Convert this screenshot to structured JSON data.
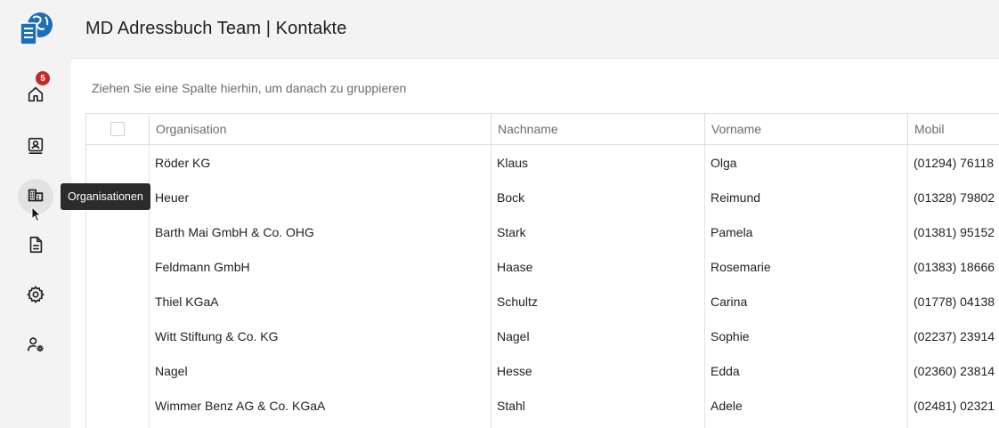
{
  "header": {
    "title": "MD Adressbuch Team | Kontakte"
  },
  "sidebar": {
    "items": [
      {
        "name": "home",
        "icon": "home-icon",
        "badge": "5"
      },
      {
        "name": "contacts",
        "icon": "contact-card-icon"
      },
      {
        "name": "organisations",
        "icon": "building-icon",
        "tooltip": "Organisationen"
      },
      {
        "name": "documents",
        "icon": "document-icon"
      },
      {
        "name": "settings",
        "icon": "gear-icon"
      },
      {
        "name": "user-settings",
        "icon": "user-gear-icon"
      }
    ]
  },
  "grid": {
    "group_panel_text": "Ziehen Sie eine Spalte hierhin, um danach zu gruppieren",
    "columns": [
      "Organisation",
      "Nachname",
      "Vorname",
      "Mobil"
    ],
    "rows": [
      [
        "Röder KG",
        "Klaus",
        "Olga",
        "(01294) 76118"
      ],
      [
        "Heuer",
        "Bock",
        "Reimund",
        "(01328) 79802"
      ],
      [
        "Barth Mai GmbH & Co. OHG",
        "Stark",
        "Pamela",
        "(01381) 95152"
      ],
      [
        "Feldmann GmbH",
        "Haase",
        "Rosemarie",
        "(01383) 18666"
      ],
      [
        "Thiel KGaA",
        "Schultz",
        "Carina",
        "(01778) 04138"
      ],
      [
        "Witt Stiftung & Co. KG",
        "Nagel",
        "Sophie",
        "(02237) 23914"
      ],
      [
        "Nagel",
        "Hesse",
        "Edda",
        "(02360) 23814"
      ],
      [
        "Wimmer Benz AG & Co. KGaA",
        "Stahl",
        "Adele",
        "(02481) 02321"
      ]
    ]
  },
  "colors": {
    "accent": "#1e6fb8",
    "badge": "#c62828",
    "tooltip_bg": "#2b2b2b"
  }
}
